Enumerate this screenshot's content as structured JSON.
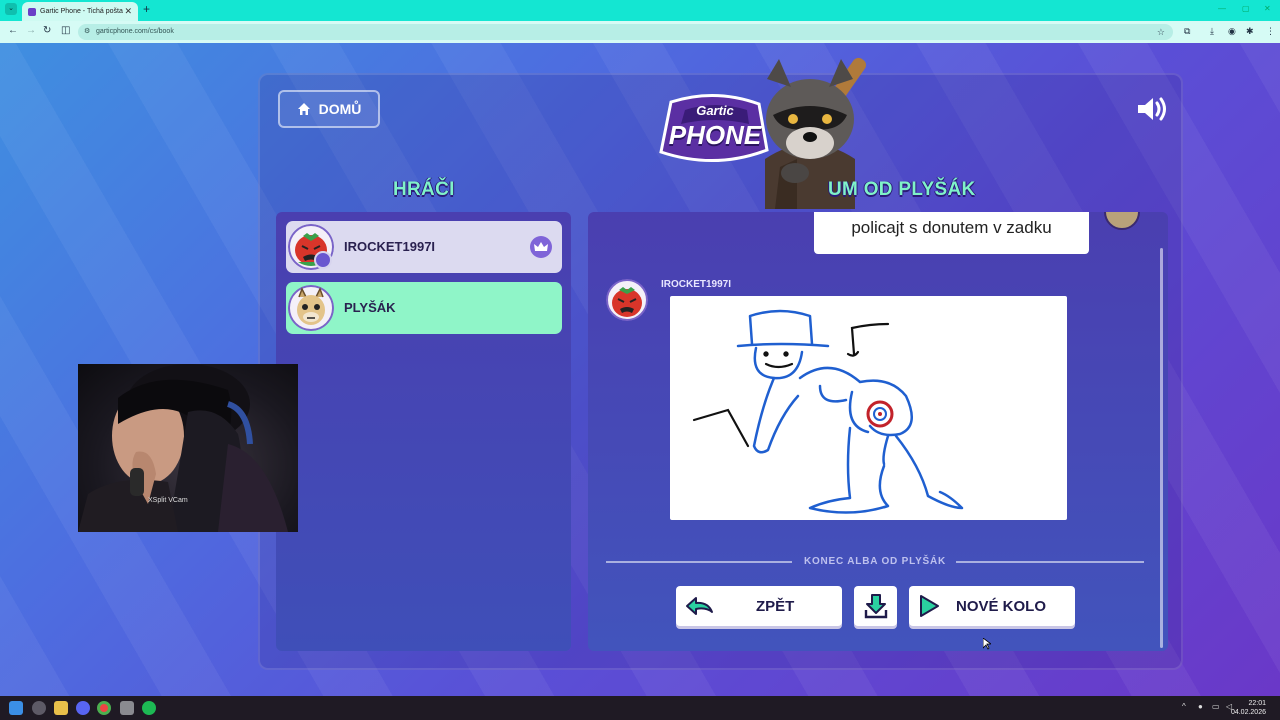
{
  "browser": {
    "tab_title": "Gartic Phone - Tichá pošta",
    "url": "garticphone.com/cs/book",
    "new_tab": "+",
    "close": "✕"
  },
  "header": {
    "home_label": "DOMŮ",
    "logo_line1": "Gartic",
    "logo_line2": "PHONE"
  },
  "players": {
    "heading": "HRÁČI",
    "items": [
      {
        "name": "IROCKET1997I",
        "host": true
      },
      {
        "name": "PLYŠÁK",
        "host": false
      }
    ]
  },
  "album": {
    "heading": "UM OD PLYŠÁK",
    "caption": "policajt s donutem v zadku",
    "entry_author": "IROCKET1997I",
    "end_label": "KONEC ALBA OD PLYŠÁK"
  },
  "actions": {
    "back_label": "ZPĚT",
    "new_round_label": "NOVÉ KOLO"
  },
  "webcam": {
    "label": "XSplit VCam"
  },
  "taskbar": {
    "time": "22:01",
    "date": "04.02.2026"
  },
  "colors": {
    "accent_green": "#7ff2c9",
    "panel": "#4a3fb0",
    "selected_player": "#8ff5c8"
  }
}
